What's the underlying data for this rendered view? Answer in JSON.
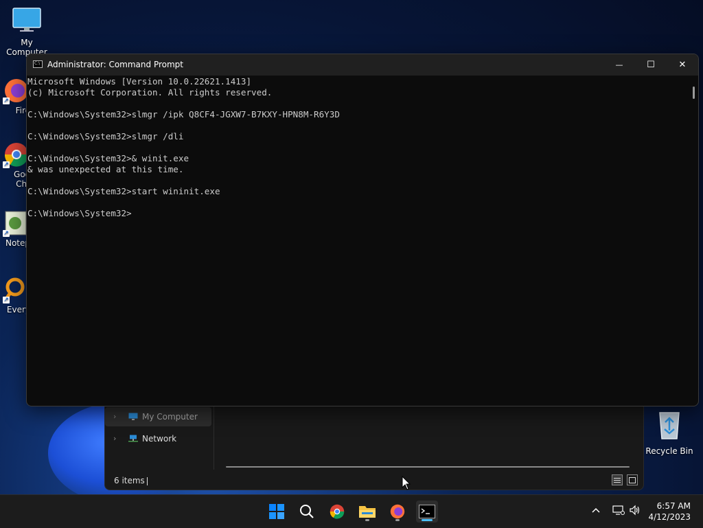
{
  "desktop": {
    "icons": [
      {
        "label": "My Computer"
      },
      {
        "label": "Fire"
      },
      {
        "label": "Goo\nChr"
      },
      {
        "label": "Notep"
      },
      {
        "label": "Every"
      },
      {
        "label": "Recycle Bin"
      }
    ]
  },
  "cmd": {
    "title": "Administrator: Command Prompt",
    "lines": [
      "Microsoft Windows [Version 10.0.22621.1413]",
      "(c) Microsoft Corporation. All rights reserved.",
      "",
      "C:\\Windows\\System32>slmgr /ipk Q8CF4-JGXW7-B7KXY-HPN8M-R6Y3D",
      "",
      "C:\\Windows\\System32>slmgr /dli",
      "",
      "C:\\Windows\\System32>& winit.exe",
      "& was unexpected at this time.",
      "",
      "C:\\Windows\\System32>start wininit.exe",
      "",
      "C:\\Windows\\System32>"
    ],
    "controls": {
      "minimize": "—",
      "maximize": "☐",
      "close": "✕"
    }
  },
  "explorer": {
    "nav": [
      {
        "label": "My Computer"
      },
      {
        "label": "Network"
      }
    ],
    "status": "6 items"
  },
  "taskbar": {
    "apps": [
      "start-icon",
      "search-icon",
      "chrome-icon",
      "file-explorer-icon",
      "firefox-icon",
      "command-prompt-icon"
    ],
    "clock_time": "6:57 AM",
    "clock_date": "4/12/2023"
  },
  "colors": {
    "accent": "#4cc2ff",
    "console_bg": "#0c0c0c",
    "console_text": "#cccccc"
  }
}
